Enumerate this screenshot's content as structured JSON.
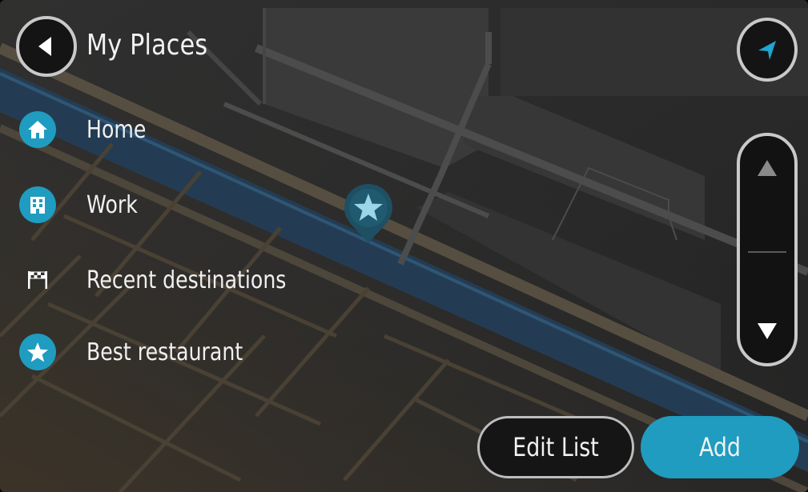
{
  "header": {
    "title": "My Places"
  },
  "list": [
    {
      "label": "Home",
      "icon": "home-icon"
    },
    {
      "label": "Work",
      "icon": "work-icon"
    },
    {
      "label": "Recent destinations",
      "icon": "checkered-flag-icon"
    },
    {
      "label": "Best restaurant",
      "icon": "star-icon"
    }
  ],
  "footer": {
    "edit_label": "Edit List",
    "add_label": "Add"
  },
  "colors": {
    "accent": "#1f9cc0",
    "map_background": "#3a3a3a",
    "road": "#6b6b6b",
    "water": "#2c4a66"
  }
}
